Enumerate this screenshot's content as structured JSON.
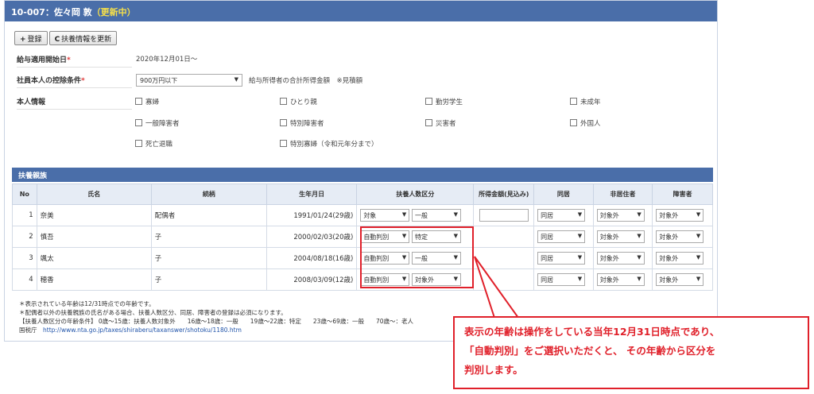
{
  "header": {
    "code_name": "10-007：佐々岡 敦",
    "status": "（更新中）"
  },
  "toolbar": {
    "register": "登録",
    "update": "扶養情報を更新",
    "register_icon": "plus-icon",
    "update_icon": "refresh-icon"
  },
  "form": {
    "start_date_label": "給与適用開始日",
    "start_date_value": "2020年12月01日～",
    "deduction_label": "社員本人の控除条件",
    "deduction_value": "900万円以下",
    "deduction_note": "給与所得者の合計所得金額　※見積額",
    "personal_label": "本人情報",
    "required_mark": "*",
    "checkboxes": [
      "寡婦",
      "ひとり親",
      "勤労学生",
      "未成年",
      "一般障害者",
      "特別障害者",
      "災害者",
      "外国人",
      "死亡退職",
      "特別寡婦（令和元年分まで）"
    ]
  },
  "family": {
    "section_title": "扶養親族",
    "columns": [
      "No",
      "氏名",
      "続柄",
      "生年月日",
      "扶養人数区分",
      "所得金額(見込み)",
      "同居",
      "非居住者",
      "障害者"
    ],
    "rows": [
      {
        "no": "1",
        "name": "奈美",
        "relation": "配偶者",
        "birth": "1991/01/24(29歳)",
        "cat1": "対象",
        "cat2": "一般",
        "income": "",
        "cohabit": "同居",
        "nonres": "対象外",
        "disab": "対象外"
      },
      {
        "no": "2",
        "name": "慎吾",
        "relation": "子",
        "birth": "2000/02/03(20歳)",
        "cat1": "自動判別",
        "cat2": "特定",
        "income": "",
        "cohabit": "同居",
        "nonres": "対象外",
        "disab": "対象外"
      },
      {
        "no": "3",
        "name": "颯太",
        "relation": "子",
        "birth": "2004/08/18(16歳)",
        "cat1": "自動判別",
        "cat2": "一般",
        "income": "",
        "cohabit": "同居",
        "nonres": "対象外",
        "disab": "対象外"
      },
      {
        "no": "4",
        "name": "穂香",
        "relation": "子",
        "birth": "2008/03/09(12歳)",
        "cat1": "自動判別",
        "cat2": "対象外",
        "income": "",
        "cohabit": "同居",
        "nonres": "対象外",
        "disab": "対象外"
      }
    ]
  },
  "notes": {
    "line1": "＊表示されている年齢は12/31時点での年齢です。",
    "line2": "＊配偶者以外の扶養親族の氏名がある場合、扶養人数区分、同居、障害者の登録は必須になります。",
    "line3": "【扶養人数区分の年齢条件】 0歳～15歳：扶養人数対象外　　16歳～18歳：一般　　19歳～22歳：特定　　23歳～69歳：一般　　70歳～：老人",
    "agency": "国税庁",
    "url": "http://www.nta.go.jp/taxes/shiraberu/taxanswer/shotoku/1180.htm"
  },
  "callout": {
    "line1": "表示の年齢は操作をしている当年12月31日時点であり、",
    "line2": "「自動判別」をご選択いただくと、 その年齢から区分を",
    "line3": "判別します。"
  },
  "colors": {
    "header_bg": "#4a6ea9",
    "status": "#f6e04a",
    "accent_red": "#e0202a"
  }
}
